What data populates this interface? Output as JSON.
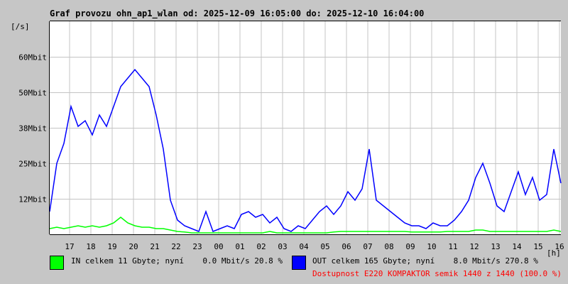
{
  "title": "Graf provozu ohn_ap1_wlan od: 2025-12-09 16:05:00 do: 2025-12-10 16:04:00",
  "unit": "[/s]",
  "legend": {
    "in": {
      "text": "IN celkem 11 Gbyte; nyní    0.0 Mbit/s 20.8 %",
      "color": "#00ff00"
    },
    "out": {
      "text": "OUT celkem 165 Gbyte; nyní    8.0 Mbit/s 270.8 %",
      "color": "#0000ff"
    },
    "availability": "Dostupnost E220 KOMPAKTOR semik 1440 z 1440 (100.0 %)"
  },
  "chart_data": {
    "type": "line",
    "title": "Graf provozu ohn_ap1_wlan od: 2025-12-09 16:05:00 do: 2025-12-10 16:04:00",
    "xlabel": "[h]",
    "ylabel": "[/s]",
    "x_start": "16:05",
    "x_step_minutes": 20,
    "ylim": [
      0,
      75
    ],
    "ytick_values": [
      12.5,
      25,
      37.5,
      50,
      62.5
    ],
    "ytick_labels": [
      "12Mbit",
      "25Mbit",
      "38Mbit",
      "50Mbit",
      "60Mbit"
    ],
    "xtick_labels": [
      "17",
      "18",
      "19",
      "20",
      "21",
      "22",
      "23",
      "00",
      "01",
      "02",
      "03",
      "04",
      "05",
      "06",
      "07",
      "08",
      "09",
      "10",
      "11",
      "12",
      "13",
      "14",
      "15",
      "16"
    ],
    "grid": true,
    "series": [
      {
        "name": "OUT",
        "color": "#0000ff",
        "values": [
          8,
          25,
          32,
          45,
          38,
          40,
          35,
          42,
          38,
          45,
          52,
          55,
          58,
          55,
          52,
          42,
          30,
          12,
          5,
          3,
          2,
          1,
          8,
          1,
          2,
          3,
          2,
          7,
          8,
          6,
          7,
          4,
          6,
          2,
          1,
          3,
          2,
          5,
          8,
          10,
          7,
          10,
          15,
          12,
          16,
          30,
          12,
          10,
          8,
          6,
          4,
          3,
          3,
          2,
          4,
          3,
          3,
          5,
          8,
          12,
          20,
          25,
          18,
          10,
          8,
          15,
          22,
          14,
          20,
          12,
          14,
          30,
          18
        ]
      },
      {
        "name": "IN",
        "color": "#00ff00",
        "values": [
          2,
          2.5,
          2,
          2.5,
          3,
          2.5,
          3,
          2.5,
          3,
          4,
          6,
          4,
          3,
          2.5,
          2.5,
          2,
          2,
          1.5,
          1,
          0.8,
          0.5,
          0.5,
          0.5,
          0.5,
          0.5,
          0.5,
          0.5,
          0.5,
          0.5,
          0.5,
          0.5,
          1,
          0.5,
          0.5,
          0.5,
          0.5,
          0.5,
          0.5,
          0.5,
          0.5,
          0.8,
          1,
          1,
          1,
          1,
          1,
          1,
          1,
          1,
          1,
          1,
          0.8,
          0.8,
          0.8,
          0.8,
          0.8,
          1,
          1,
          1,
          1,
          1.5,
          1.5,
          1,
          1,
          1,
          1,
          1,
          1,
          1,
          1,
          1,
          1.5,
          1
        ]
      }
    ]
  }
}
